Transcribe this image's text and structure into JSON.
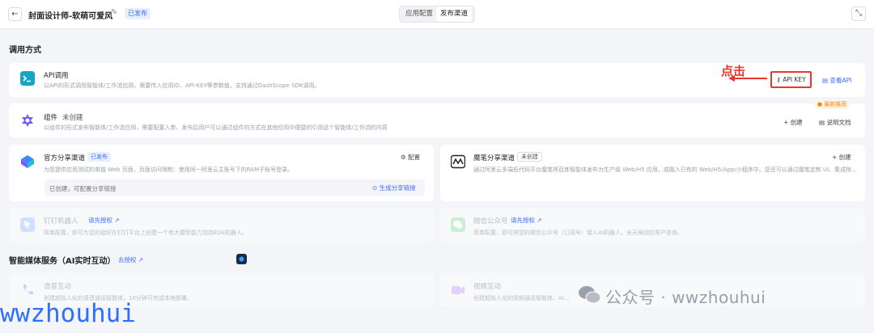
{
  "header": {
    "back_icon": "arrow-left-icon",
    "title": "封面设计师-软萌可爱风",
    "edit_icon": "pencil-icon",
    "status_badge": "已发布",
    "tabs": [
      {
        "label": "应用配置",
        "active": false
      },
      {
        "label": "发布渠道",
        "active": true
      }
    ],
    "expand_icon": "collapse-icon"
  },
  "invoke_section": {
    "title": "调用方式",
    "api_card": {
      "title": "API调用",
      "description": "以API的形式调用智能体/工作流应用，需要传入应用ID、API-KEY等参数值，支持通过DashScope SDK调用。",
      "api_key_button": "API KEY",
      "view_api_link": "查看API",
      "annotation": "点击"
    },
    "component_card": {
      "title": "组件",
      "status": "未创建",
      "description": "以组件的形式发布智能体/工作流应用，需要配置入参、发布后用户可以通过组件的方式在其他应用中便捷的引用这个智能体/工作流的内容",
      "badge": "最新推荐",
      "create_button": "创建",
      "docs_button": "说明文档"
    }
  },
  "share_channels": {
    "official": {
      "title": "官方分享渠道",
      "status": "已发布",
      "description": "为您提供应用测试的单独 Web 页面，页面访问限制：使用同一阿里云主账号下的RAM子账号登录。",
      "config_button": "配置",
      "info_text": "已创建，可配置分享链接",
      "generate_link": "生成分享链接"
    },
    "modelscope": {
      "title": "魔笔分享渠道",
      "status": "未创建",
      "description": "通过阿里云多端低代码平台魔笔将百炼智能体发布为生产级 Web/H5 应用，或融入已有的 Web/H5/App/小程序中。您还可以通过魔笔定制 UI、集成除...",
      "create_button": "创建"
    }
  },
  "bot_channels": {
    "dingtalk": {
      "title": "钉钉机器人",
      "auth_link": "请先授权",
      "description": "简单配置，即可为您的组织在钉钉平台上创建一个有大模型能力加持的AI机器人。"
    },
    "wechat": {
      "title": "微信公众号",
      "auth_link": "请先授权",
      "description": "简单配置，即可将您的微信公众号（订阅号）接入AI机器人，全天候回应客户咨询。"
    }
  },
  "media_section": {
    "title": "智能媒体服务（AI实时互动）",
    "auth_link": "去授权",
    "voice": {
      "title": "语音互动",
      "description": "创建超拟人化的语音通话智能体，10分钟可完成本地部署。"
    },
    "video": {
      "title": "视频互动",
      "description": "创建超拟人化的视频通话智能体，AI..."
    }
  },
  "watermarks": {
    "right": "公众号 · wwzhouhui",
    "left": "wwzhouhui"
  },
  "colors": {
    "accent": "#3d6bff",
    "annotation_red": "#e8382b",
    "recommend_orange": "#f08a24"
  }
}
